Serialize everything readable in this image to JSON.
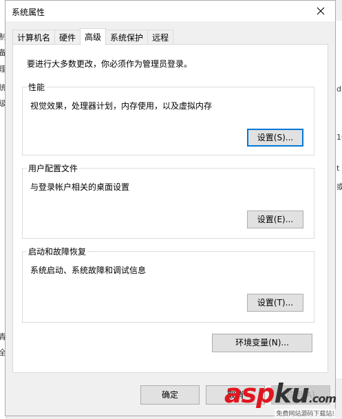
{
  "window": {
    "title": "系统属性"
  },
  "tabs": [
    {
      "label": "计算机名"
    },
    {
      "label": "硬件"
    },
    {
      "label": "高级"
    },
    {
      "label": "系统保护"
    },
    {
      "label": "远程"
    }
  ],
  "active_tab": "高级",
  "notice": "要进行大多数更改，你必须作为管理员登录。",
  "groups": {
    "performance": {
      "title": "性能",
      "desc": "视觉效果，处理器计划，内存使用，以及虚拟内存",
      "button": "设置(S)..."
    },
    "user_profiles": {
      "title": "用户配置文件",
      "desc": "与登录帐户相关的桌面设置",
      "button": "设置(E)..."
    },
    "startup_recovery": {
      "title": "启动和故障恢复",
      "desc": "系统启动、系统故障和调试信息",
      "button": "设置(T)..."
    }
  },
  "env_button": "环境变量(N)...",
  "footer": {
    "ok": "确定",
    "cancel": "取消",
    "apply": "应用(A)"
  },
  "background": {
    "left_chars": [
      "制",
      "备",
      "理",
      "统",
      "级",
      "青",
      "全"
    ],
    "right_chars": [
      "d.",
      "10",
      "t",
      "或"
    ]
  },
  "watermark": {
    "brand_a": "asp",
    "brand_b": "ku",
    "brand_c": ".com",
    "sub": "免费网站源码下载站!"
  },
  "colors": {
    "focus_border": "#0078d7",
    "button_bg": "#e1e1e1",
    "watermark_red": "#e0161f"
  }
}
